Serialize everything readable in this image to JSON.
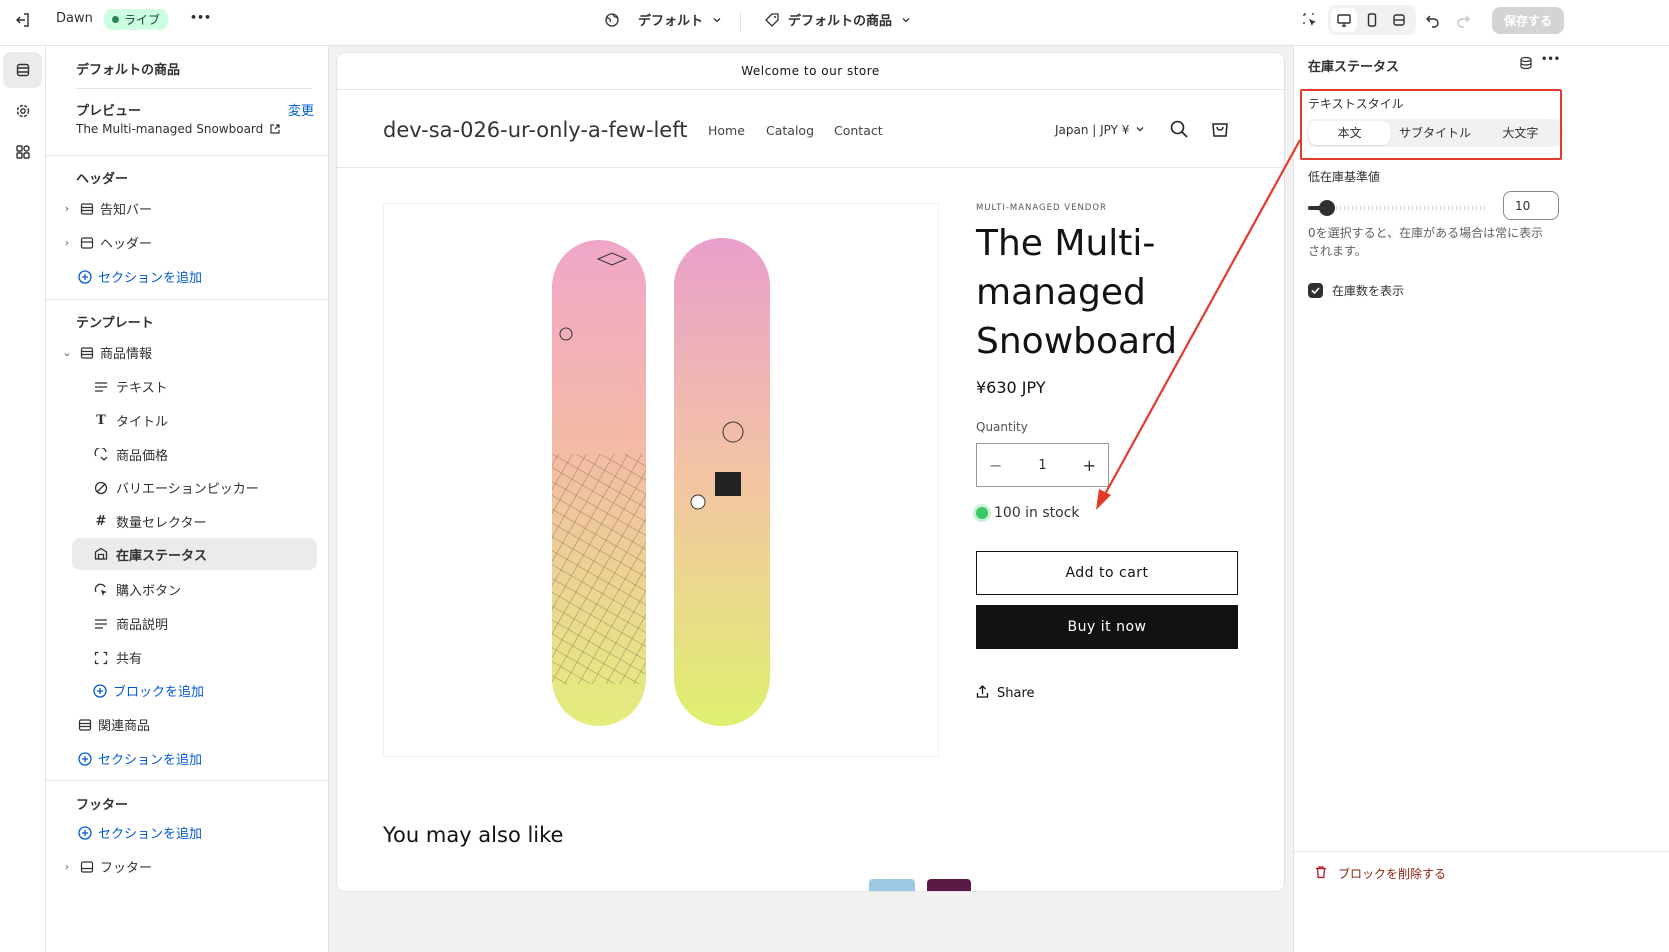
{
  "topbar": {
    "back_icon": "exit-icon",
    "theme_name": "Dawn",
    "live_label": "ライブ",
    "more_label": "•••",
    "template_label": "デフォルト",
    "product_label": "デフォルトの商品",
    "save_label": "保存する"
  },
  "left": {
    "panel_title": "デフォルトの商品",
    "preview_label": "プレビュー",
    "preview_change": "変更",
    "preview_product": "The Multi-managed Snowboard",
    "header_section": "ヘッダー",
    "header_items": [
      "告知バー",
      "ヘッダー"
    ],
    "add_section": "セクションを追加",
    "template_section": "テンプレート",
    "product_info": "商品情報",
    "blocks": [
      "テキスト",
      "タイトル",
      "商品価格",
      "バリエーションピッカー",
      "数量セレクター",
      "在庫ステータス",
      "購入ボタン",
      "商品説明",
      "共有"
    ],
    "add_block": "ブロックを追加",
    "related": "関連商品",
    "footer_section": "フッター",
    "footer_item": "フッター"
  },
  "store": {
    "announcement": "Welcome to our store",
    "store_name": "dev-sa-026-ur-only-a-few-left",
    "nav": [
      "Home",
      "Catalog",
      "Contact"
    ],
    "locale": "Japan | JPY ¥",
    "vendor": "MULTI-MANAGED VENDOR",
    "title_lines": [
      "The Multi-",
      "managed",
      "Snowboard"
    ],
    "price": "¥630 JPY",
    "quantity_label": "Quantity",
    "quantity_value": "1",
    "stock": "100 in stock",
    "add_to_cart": "Add to cart",
    "buy_now": "Buy it now",
    "share": "Share",
    "also_like": "You may also like"
  },
  "right": {
    "panel_title": "在庫ステータス",
    "text_style_label": "テキストスタイル",
    "text_style_options": [
      "本文",
      "サブタイトル",
      "大文字"
    ],
    "text_style_selected": "本文",
    "threshold_label": "低在庫基準値",
    "threshold_value": "10",
    "threshold_fraction": 0.06,
    "threshold_help": "0を選択すると、在庫がある場合は常に表示されます。",
    "show_count_label": "在庫数を表示",
    "show_count_checked": true,
    "delete_label": "ブロックを削除する"
  },
  "colors": {
    "accent_blue": "#005bd3",
    "annotation_red": "#e33b2b",
    "stock_green": "#3ac765",
    "buy_now_bg": "#121212"
  }
}
